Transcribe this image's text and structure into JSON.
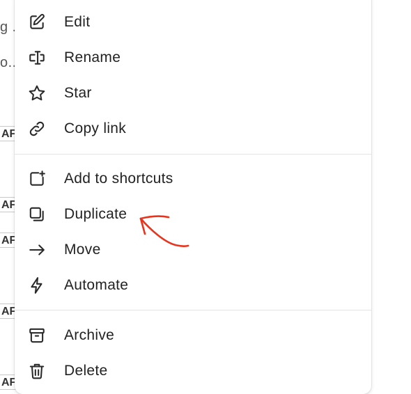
{
  "background": {
    "fragments": [
      "g .",
      "o..."
    ],
    "tags": [
      "AF",
      "AF",
      "AF",
      "AF",
      "AF"
    ]
  },
  "menu": {
    "groups": [
      {
        "items": [
          {
            "label": "Edit",
            "icon": "edit-icon"
          },
          {
            "label": "Rename",
            "icon": "rename-icon"
          },
          {
            "label": "Star",
            "icon": "star-icon"
          },
          {
            "label": "Copy link",
            "icon": "link-icon"
          }
        ]
      },
      {
        "items": [
          {
            "label": "Add to shortcuts",
            "icon": "add-shortcut-icon"
          },
          {
            "label": "Duplicate",
            "icon": "duplicate-icon"
          },
          {
            "label": "Move",
            "icon": "arrow-right-icon"
          },
          {
            "label": "Automate",
            "icon": "lightning-icon"
          }
        ]
      },
      {
        "items": [
          {
            "label": "Archive",
            "icon": "archive-icon"
          },
          {
            "label": "Delete",
            "icon": "trash-icon"
          }
        ]
      }
    ]
  },
  "annotation": {
    "color": "#e8341c",
    "points_to": "Duplicate"
  }
}
